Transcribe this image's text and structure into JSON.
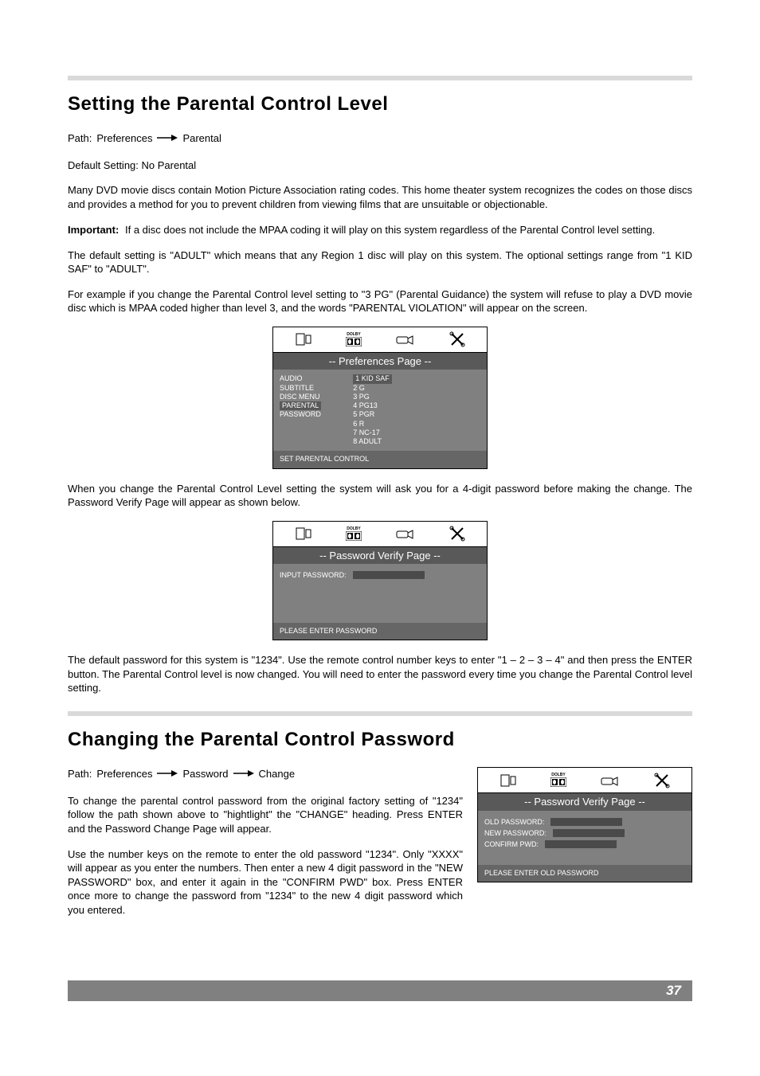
{
  "page_number": "37",
  "section1": {
    "heading": "Setting the Parental Control Level",
    "path_label": "Path:",
    "path_seg1": "Preferences",
    "path_seg2": "Parental",
    "default_setting": "Default Setting: No Parental",
    "para1": "Many DVD movie discs contain Motion Picture Association rating codes. This home theater system recognizes the codes on those discs and provides a method for you to prevent children from viewing films that are unsuitable or objectionable.",
    "important_label": "Important:",
    "important_text": "If a disc does not include the MPAA coding it will play on this system regardless of the Parental Control level setting.",
    "para2": "The default setting is \"ADULT\" which means that any Region 1 disc will play on this system. The optional settings range from \"1 KID SAF\" to \"ADULT\".",
    "para3": "For example if you change the Parental Control level setting to \"3 PG\" (Parental Guidance) the system will refuse to play a DVD movie disc which is MPAA coded higher than level 3, and the words \"PARENTAL VIOLATION\" will appear on the screen.",
    "osd1": {
      "title": "-- Preferences  Page --",
      "left_items": [
        "AUDIO",
        "SUBTITLE",
        "DISC MENU",
        "PARENTAL",
        "PASSWORD"
      ],
      "left_highlight_index": 3,
      "right_items": [
        "1 KID SAF",
        "2 G",
        "3 PG",
        "4 PG13",
        "5 PGR",
        "6 R",
        "7 NC-17",
        "8 ADULT"
      ],
      "right_highlight_index": 0,
      "footer": "SET PARENTAL CONTROL"
    },
    "para4": "When you change the Parental Control Level setting the system will ask you for a 4-digit password before making the change. The Password Verify Page will appear as shown below.",
    "osd2": {
      "title": "-- Password  Verify  Page --",
      "input_label": "INPUT PASSWORD:",
      "footer": "PLEASE ENTER PASSWORD"
    },
    "para5": "The default password for this system is \"1234\". Use the remote control number keys to enter \"1 – 2 – 3 – 4\" and then press the ENTER button. The Parental Control level is now changed. You will need to enter the password every time you change the Parental Control level setting."
  },
  "section2": {
    "heading": "Changing the Parental Control Password",
    "path_label": "Path:",
    "path_seg1": "Preferences",
    "path_seg2": "Password",
    "path_seg3": "Change",
    "para1": "To change the parental control password from the original factory setting of \"1234\" follow the path shown above to \"hightlight\" the \"CHANGE\" heading. Press ENTER and the Password Change Page will appear.",
    "para2": "Use the number keys on the remote to enter the old password \"1234\". Only \"XXXX\" will appear as you enter the numbers. Then enter a new 4 digit password in the \"NEW PASSWORD\" box, and enter it again in the \"CONFIRM PWD\" box. Press ENTER once more to change the password from \"1234\" to the new 4 digit password which you entered.",
    "osd3": {
      "title": "-- Password  Verify  Page --",
      "rows": [
        "OLD PASSWORD:",
        "NEW PASSWORD:",
        "CONFIRM PWD:"
      ],
      "footer": "PLEASE ENTER OLD PASSWORD"
    }
  },
  "icons": {
    "dolby_text": "DOLBY"
  }
}
